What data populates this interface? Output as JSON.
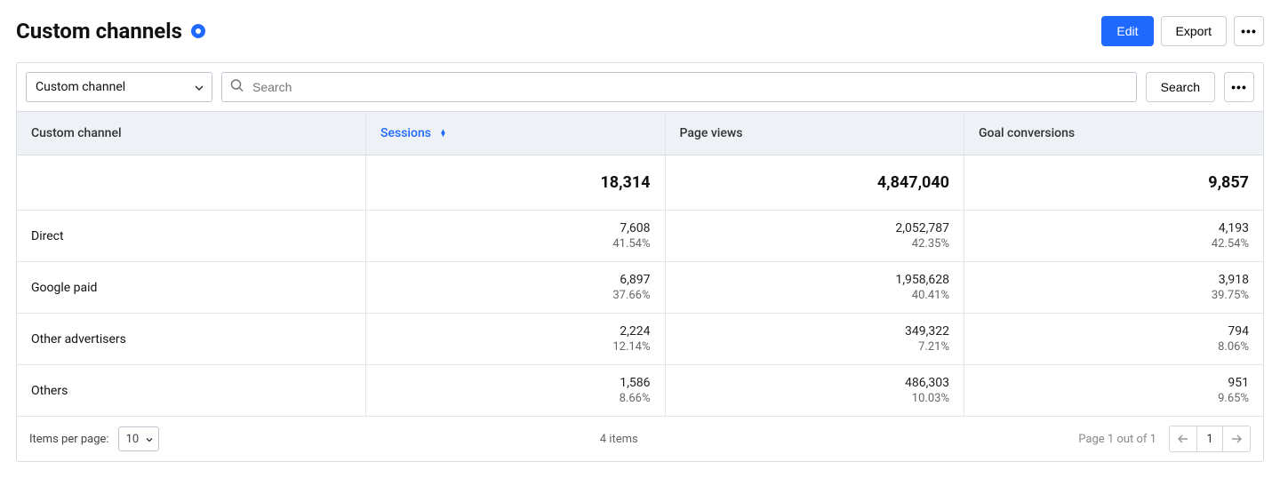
{
  "header": {
    "title": "Custom channels",
    "edit_label": "Edit",
    "export_label": "Export"
  },
  "toolbar": {
    "group_by": "Custom channel",
    "search_placeholder": "Search",
    "search_button": "Search"
  },
  "table": {
    "columns": {
      "name": "Custom channel",
      "sessions": "Sessions",
      "page_views": "Page views",
      "goal_conversions": "Goal conversions"
    },
    "totals": {
      "sessions": "18,314",
      "page_views": "4,847,040",
      "goal_conversions": "9,857"
    },
    "rows": [
      {
        "name": "Direct",
        "sessions": "7,608",
        "sessions_pct": "41.54%",
        "page_views": "2,052,787",
        "page_views_pct": "42.35%",
        "goal_conversions": "4,193",
        "goal_conversions_pct": "42.54%"
      },
      {
        "name": "Google paid",
        "sessions": "6,897",
        "sessions_pct": "37.66%",
        "page_views": "1,958,628",
        "page_views_pct": "40.41%",
        "goal_conversions": "3,918",
        "goal_conversions_pct": "39.75%"
      },
      {
        "name": "Other advertisers",
        "sessions": "2,224",
        "sessions_pct": "12.14%",
        "page_views": "349,322",
        "page_views_pct": "7.21%",
        "goal_conversions": "794",
        "goal_conversions_pct": "8.06%"
      },
      {
        "name": "Others",
        "sessions": "1,586",
        "sessions_pct": "8.66%",
        "page_views": "486,303",
        "page_views_pct": "10.03%",
        "goal_conversions": "951",
        "goal_conversions_pct": "9.65%"
      }
    ]
  },
  "footer": {
    "items_per_page_label": "Items per page:",
    "items_per_page_value": "10",
    "item_count": "4 items",
    "page_text": "Page 1 out of 1",
    "current_page": "1"
  }
}
